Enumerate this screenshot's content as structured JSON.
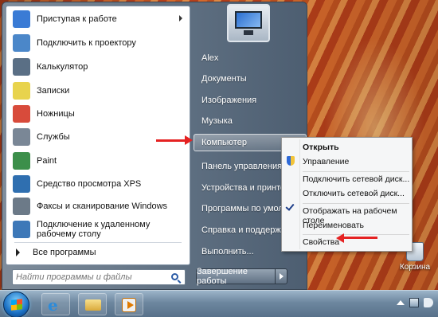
{
  "start_menu": {
    "programs": [
      {
        "label": "Приступая к работе",
        "has_arrow": true,
        "icon": "getting-started-icon",
        "color": "#3a7bd5"
      },
      {
        "label": "Подключить к проектору",
        "icon": "projector-icon",
        "color": "#4b87c9"
      },
      {
        "label": "Калькулятор",
        "icon": "calculator-icon",
        "color": "#5a6f85"
      },
      {
        "label": "Записки",
        "icon": "sticky-notes-icon",
        "color": "#e8d34d"
      },
      {
        "label": "Ножницы",
        "icon": "scissors-icon",
        "color": "#d84b3b"
      },
      {
        "label": "Службы",
        "icon": "services-gear-icon",
        "color": "#7a8796"
      },
      {
        "label": "Paint",
        "icon": "paint-icon",
        "color": "#3c8f4a"
      },
      {
        "label": "Средство просмотра XPS",
        "icon": "xps-viewer-icon",
        "color": "#2f6fb0"
      },
      {
        "label": "Факсы и сканирование Windows",
        "icon": "fax-scan-icon",
        "color": "#6c7a88"
      },
      {
        "label": "Подключение к удаленному рабочему столу",
        "icon": "remote-desktop-icon",
        "color": "#3d78b8"
      }
    ],
    "all_programs": "Все программы",
    "search_placeholder": "Найти программы и файлы",
    "right_links": {
      "user": "Alex",
      "documents": "Документы",
      "pictures": "Изображения",
      "music": "Музыка",
      "computer": "Компьютер",
      "control_panel": "Панель управления",
      "devices": "Устройства и принтеры",
      "default_programs": "Программы по умолчан",
      "help": "Справка и поддержка",
      "run": "Выполнить..."
    },
    "shutdown": "Завершение работы"
  },
  "context_menu": {
    "open": "Открыть",
    "manage": "Управление",
    "map_drive": "Подключить сетевой диск...",
    "disconnect_drive": "Отключить сетевой диск...",
    "show_on_desktop": "Отображать на рабочем столе",
    "rename": "Переименовать",
    "properties": "Свойства"
  },
  "desktop": {
    "recycle_bin": "Корзина"
  },
  "colors": {
    "arrow": "#e52222",
    "taskbar": "#6d879f"
  }
}
